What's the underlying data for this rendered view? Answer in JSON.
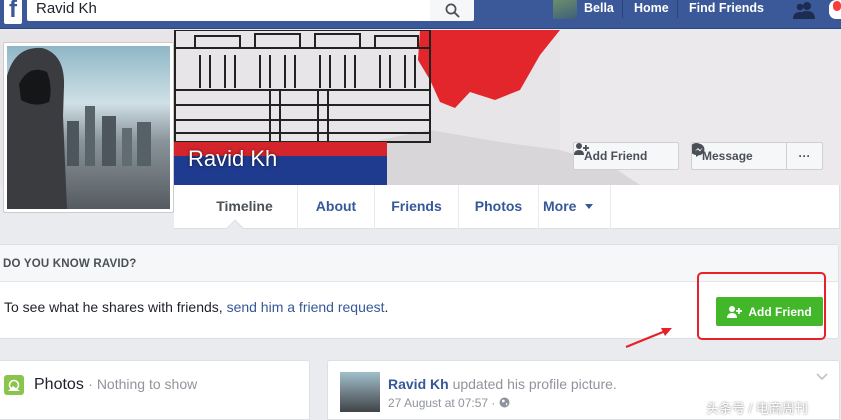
{
  "colors": {
    "brand": "#3b5998",
    "link": "#365899",
    "add_friend_green": "#42b72a",
    "annotation_red": "#e8202a"
  },
  "topbar": {
    "logo_letter": "f",
    "search_value": "Ravid Kh",
    "search_icon": "search-icon",
    "nav": {
      "user_name": "Bella",
      "home": "Home",
      "find_friends": "Find Friends"
    },
    "icons": [
      "friends-icon",
      "notifications-icon"
    ]
  },
  "profile": {
    "name": "Ravid Kh",
    "cover_buttons": {
      "add_friend": "Add Friend",
      "message": "Message",
      "more": "···"
    }
  },
  "tabs": [
    {
      "label": "Timeline",
      "active": true
    },
    {
      "label": "About"
    },
    {
      "label": "Friends"
    },
    {
      "label": "Photos"
    },
    {
      "label": "More"
    }
  ],
  "know_panel": {
    "title": "DO YOU KNOW RAVID?",
    "text_before": "To see what he shares with friends, ",
    "link_text": "send him a friend request",
    "text_after": ".",
    "button": "Add Friend"
  },
  "photos_card": {
    "title": "Photos",
    "subtitle": "· Nothing to show"
  },
  "post": {
    "author": "Ravid Kh",
    "action": " updated his profile picture.",
    "date": "27 August at 07:57 ·",
    "privacy_icon": "globe-icon"
  },
  "watermark": "头条号 / 电商周刊"
}
